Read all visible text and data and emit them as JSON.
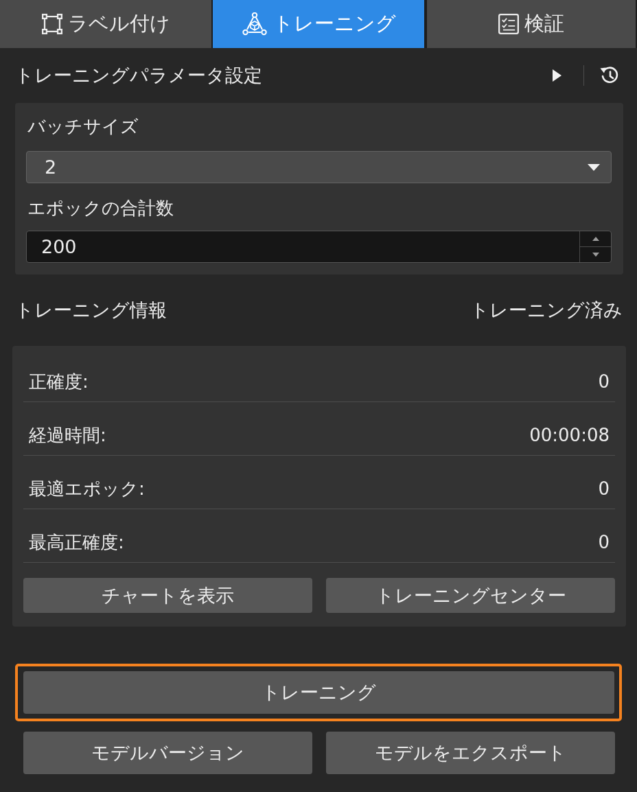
{
  "tabs": [
    {
      "label": "ラベル付け",
      "selected": false
    },
    {
      "label": "トレーニング",
      "selected": true
    },
    {
      "label": "検証",
      "selected": false
    }
  ],
  "parameters": {
    "title": "トレーニングパラメータ設定",
    "fields": [
      {
        "kind": "select",
        "label": "バッチサイズ",
        "value": "2"
      },
      {
        "kind": "number",
        "label": "エポックの合計数",
        "value": "200"
      }
    ]
  },
  "info": {
    "title": "トレーニング情報",
    "status": "トレーニング済み",
    "rows": [
      {
        "label": "正確度:",
        "value": "0"
      },
      {
        "label": "経過時間:",
        "value": "00:00:08"
      },
      {
        "label": "最適エポック:",
        "value": "0"
      },
      {
        "label": "最高正確度:",
        "value": "0"
      }
    ],
    "buttons": [
      "チャートを表示",
      "トレーニングセンター"
    ]
  },
  "train_button": {
    "label": "トレーニング",
    "focused": true
  },
  "footer_buttons": [
    "モデルバージョン",
    "モデルをエクスポート"
  ]
}
